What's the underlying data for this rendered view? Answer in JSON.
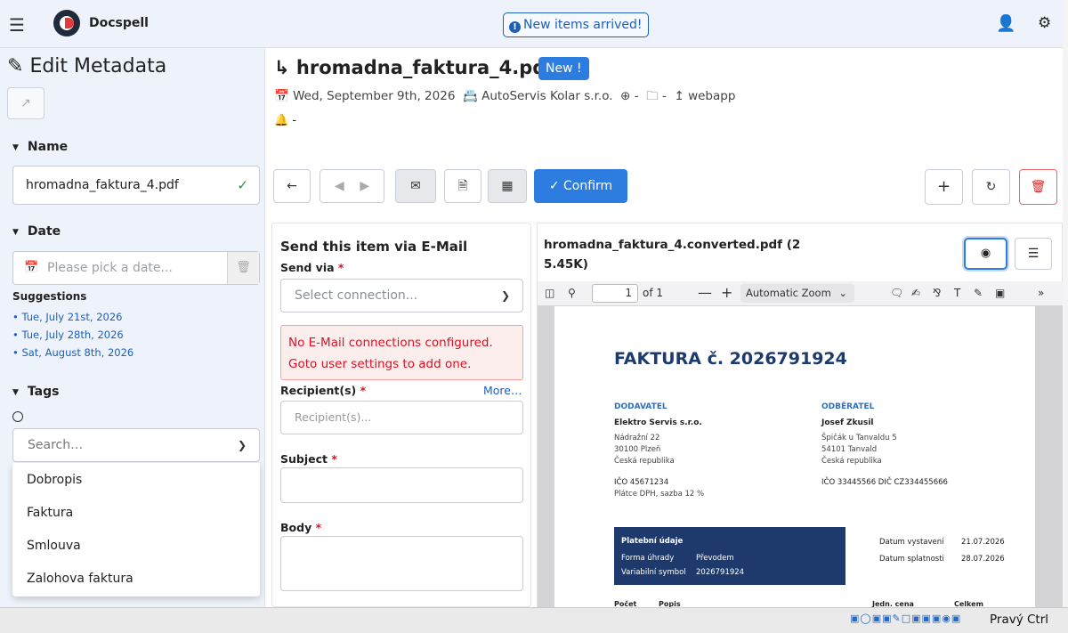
{
  "topbar": {
    "brand": "Docspell",
    "notification": "New items arrived!"
  },
  "sidebar": {
    "title": "Edit Metadata",
    "name_section": "Name",
    "name_value": "hromadna_faktura_4.pdf",
    "date_section": "Date",
    "date_placeholder": "Please pick a date...",
    "suggestions_label": "Suggestions",
    "suggestions": [
      "Tue, July 21st, 2026",
      "Tue, July 28th, 2026",
      "Sat, August 8th, 2026"
    ],
    "tags_section": "Tags",
    "tags_placeholder": "Search…",
    "tag_options": [
      "Dobropis",
      "Faktura",
      "Smlouva",
      "Zalohova faktura"
    ]
  },
  "item": {
    "title": "hromadna_faktura_4.pdf",
    "badge": "New !",
    "date": "Wed, September 9th, 2026",
    "correspondent": "AutoServis Kolar s.r.o.",
    "concerning": "-",
    "folder": "-",
    "source": "webapp",
    "due": "-"
  },
  "toolbar": {
    "confirm": "Confirm"
  },
  "email": {
    "title": "Send this item via E-Mail",
    "send_via_label": "Send via",
    "send_via_placeholder": "Select connection...",
    "error_line1": "No E-Mail connections configured.",
    "error_line2": "Goto user settings to add one.",
    "recipients_label": "Recipient(s)",
    "more_link": "More…",
    "recipients_placeholder": "Recipient(s)...",
    "subject_label": "Subject",
    "body_label": "Body",
    "required_mark": "*"
  },
  "pdf": {
    "name_line1": "hromadna_faktura_4.converted.pdf (2",
    "name_line2": "5.45K)",
    "page": "1",
    "of_pages": "of 1",
    "zoom": "Automatic Zoom",
    "doc_title": "FAKTURA č. 2026791924",
    "supplier_head": "DODAVATEL",
    "supplier_name": "Elektro Servis s.r.o.",
    "supplier_addr1": "Nádražní 22",
    "supplier_addr2": "30100 Plzeň",
    "supplier_addr3": "Česká republika",
    "supplier_ico": "IČO 45671234",
    "supplier_vat": "Plátce DPH, sazba 12 %",
    "buyer_head": "ODBĚRATEL",
    "buyer_name": "Josef Zkusil",
    "buyer_addr1": "Špičák u Tanvaldu 5",
    "buyer_addr2": "54101 Tanvald",
    "buyer_addr3": "Česká republika",
    "buyer_ico": "IČO 33445566  DIČ CZ334455666",
    "pay_head": "Platební údaje",
    "pay_form_label": "Forma úhrady",
    "pay_form": "Převodem",
    "pay_vs_label": "Variabilní symbol",
    "pay_vs": "2026791924",
    "issued_label": "Datum vystavení",
    "issued": "21.07.2026",
    "due_label": "Datum splatnosti",
    "due": "28.07.2026",
    "col_count": "Počet",
    "col_desc": "Popis",
    "col_unit": "Jedn. cena",
    "col_total": "Celkem"
  },
  "statusbar": {
    "host_key": "Pravý Ctrl"
  },
  "colors": {
    "accent": "#2d7de0",
    "error": "#dd1122",
    "sidebar_bg": "#eef3fb",
    "invoice_blue": "#1e3a6d"
  }
}
